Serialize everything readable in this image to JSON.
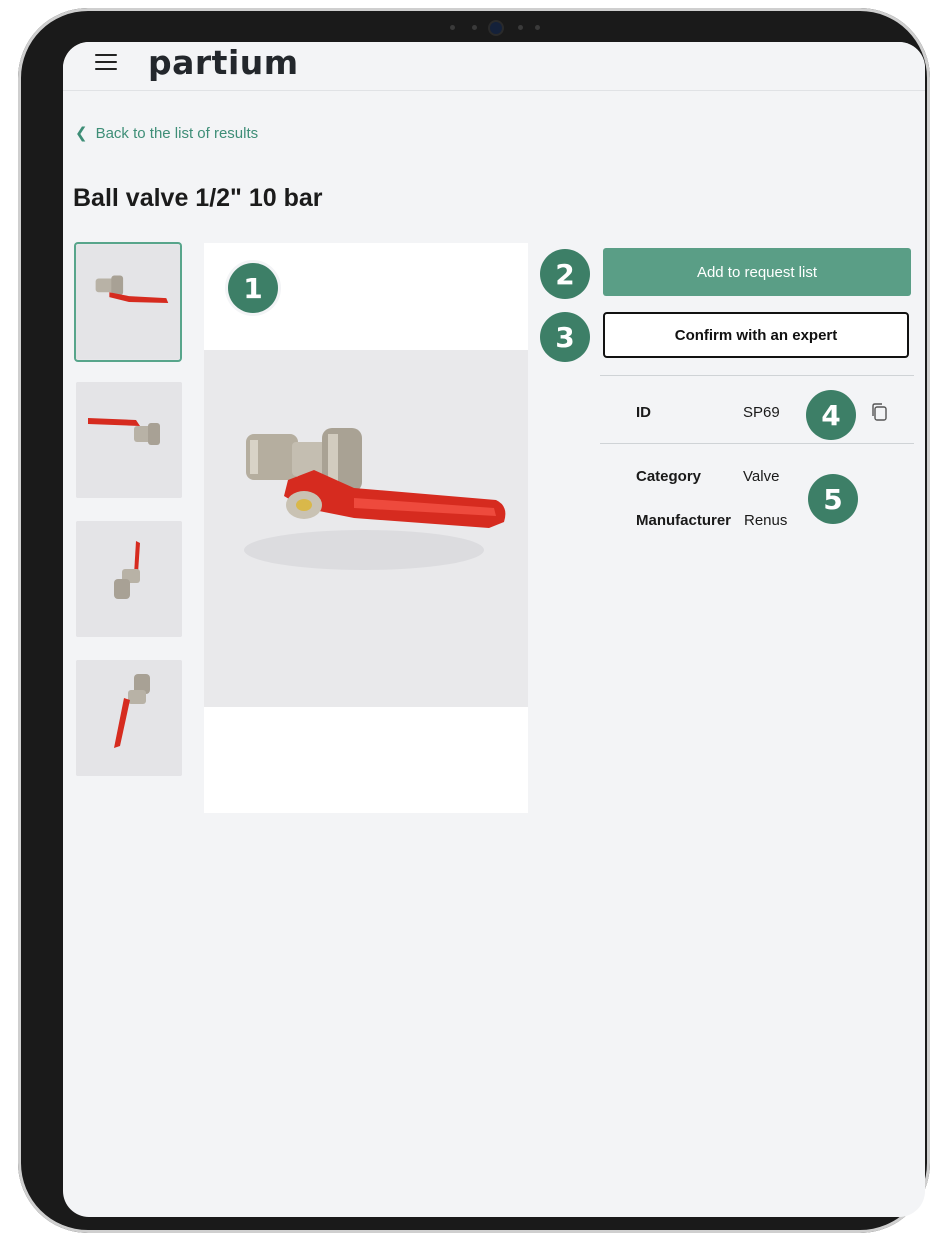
{
  "app": {
    "brand": "partium"
  },
  "nav": {
    "back_label": "Back to the list of results"
  },
  "product": {
    "title": "Ball valve 1/2\" 10 bar",
    "thumbnails": [
      "thumbnail-1",
      "thumbnail-2",
      "thumbnail-3",
      "thumbnail-4"
    ]
  },
  "actions": {
    "add_to_request": "Add to request list",
    "confirm_expert": "Confirm with an expert"
  },
  "attributes": {
    "id_label": "ID",
    "id_value": "SP69",
    "category_label": "Category",
    "category_value": "Valve",
    "manufacturer_label": "Manufacturer",
    "manufacturer_value": "Renus"
  },
  "badges": [
    "1",
    "2",
    "3",
    "4",
    "5"
  ],
  "colors": {
    "accent": "#5a9e86",
    "badge": "#3d7f67",
    "link": "#3e8e77",
    "valve_handle": "#d62b1f"
  },
  "icons": {
    "menu": "hamburger-menu-icon",
    "back": "chevron-left-icon",
    "copy": "copy-icon"
  }
}
